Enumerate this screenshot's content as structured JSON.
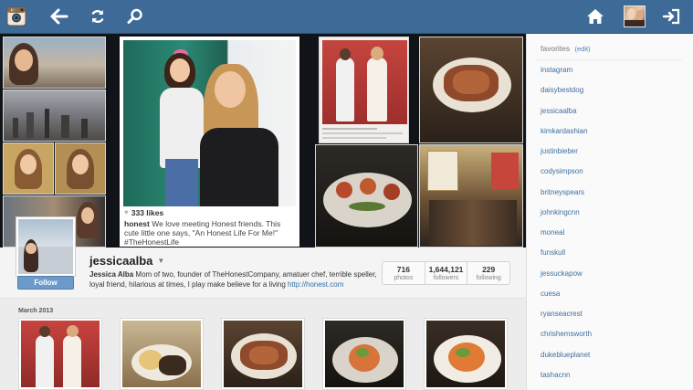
{
  "topbar": {
    "buttons": [
      {
        "name": "instagram-logo-icon"
      },
      {
        "name": "back-arrow-icon"
      },
      {
        "name": "refresh-icon"
      },
      {
        "name": "search-icon"
      },
      {
        "name": "home-icon"
      },
      {
        "name": "user-avatar"
      },
      {
        "name": "sign-out-icon"
      }
    ],
    "bar_color": "#3d6a97"
  },
  "featured_post": {
    "likes": "333 likes",
    "username": "honest",
    "caption": "We love meeting Honest friends. This cute little one says, \"An Honest Life For Me!\" #TheHonestLife"
  },
  "profile": {
    "username": "jessicaalba",
    "full_name": "Jessica Alba",
    "bio": "Mom of two, founder of TheHonestCompany, amatuer chef, terrible speller, loyal friend, hilarious at times, I play make believe for a living",
    "link": "http://honest.com",
    "follow_label": "Follow",
    "stats": [
      {
        "value": "716",
        "label": "photos"
      },
      {
        "value": "1,644,121",
        "label": "followers"
      },
      {
        "value": "229",
        "label": "following"
      }
    ]
  },
  "grid": {
    "month": "March 2013"
  },
  "sidebar": {
    "title": "favorites",
    "edit_label": "(edit)",
    "favorites": [
      "instagram",
      "daisybestdog",
      "jessicaalba",
      "kimkardashian",
      "justinbieber",
      "codysimpson",
      "britneyspears",
      "johnkingcnn",
      "moneal",
      "funskull",
      "jessuckapow",
      "cuesa",
      "ryanseacrest",
      "chrishemsworth",
      "dukeblueplanet",
      "tashacnn"
    ]
  }
}
